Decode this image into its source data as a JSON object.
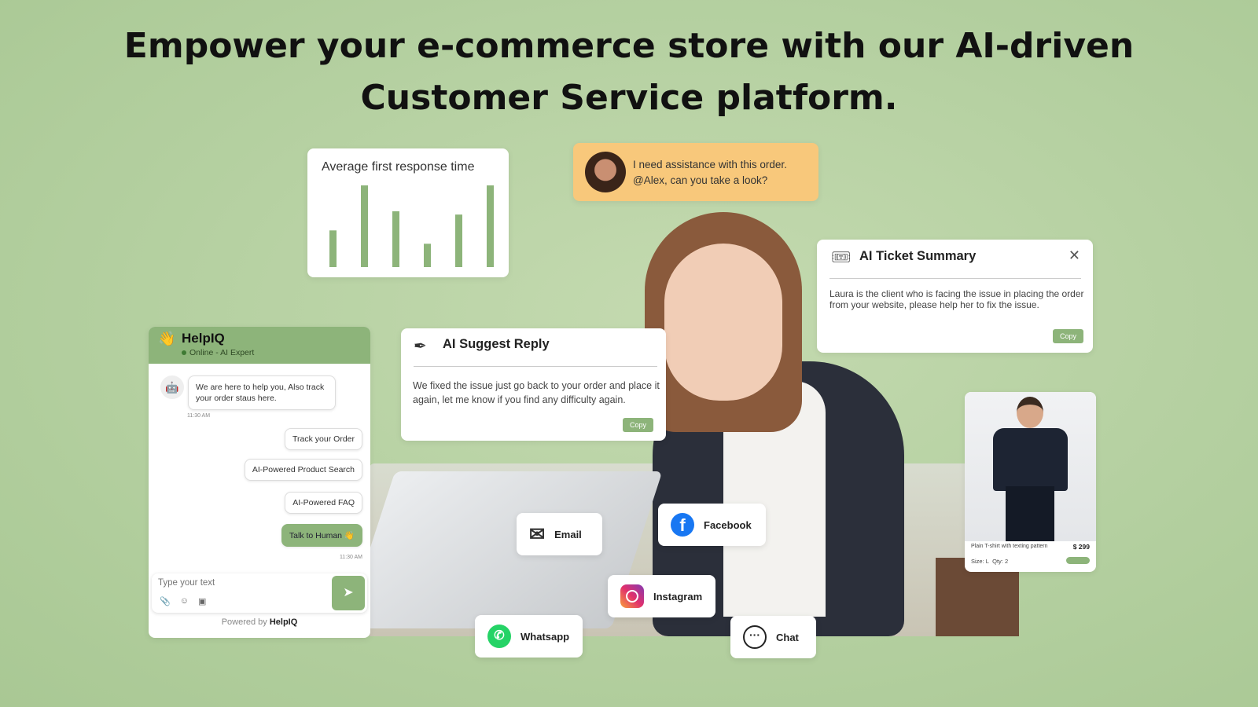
{
  "headline": {
    "line1": "Empower your e-commerce store with our AI-driven",
    "line2": "Customer Service platform."
  },
  "chart_card": {
    "title": "Average first response time"
  },
  "chart_data": {
    "type": "bar",
    "title": "Average first response time",
    "values": [
      44,
      98,
      67,
      28,
      63,
      98
    ],
    "color": "#8db47a",
    "grid": false
  },
  "quote": {
    "text1": "I need assistance with this order.",
    "text2": "@Alex, can you take a look?",
    "bg": "#f8c87b"
  },
  "ticket": {
    "title": "AI Ticket Summary",
    "body": "Laura is the client who is facing the issue in placing the order from your website, please help her to fix the issue.",
    "copy": "Copy"
  },
  "suggest": {
    "title": "AI Suggest Reply",
    "body": "We fixed the issue just go back to your order and  place it again, let me know if you find any difficulty again.",
    "copy": "Copy"
  },
  "helpiq": {
    "name": "HelpIQ",
    "status": "Online - AI Expert",
    "bot_message": "We are here to help you, Also track your order staus here.",
    "time1": "11:30 AM",
    "options": [
      "Track your Order",
      "AI-Powered Product Search",
      "AI-Powered FAQ"
    ],
    "talk": "Talk to Human 👋",
    "time2": "11:30 AM",
    "placeholder": "Type your text",
    "powered": "Powered by",
    "brand": "HelpIQ",
    "accent": "#8db47a"
  },
  "product": {
    "name": "Plain T-shirt with texting pattern",
    "price": "$ 299",
    "size": "Size: L",
    "qty": "Qty: 2"
  },
  "channels": {
    "email": "Email",
    "facebook": "Facebook",
    "instagram": "Instagram",
    "whatsapp": "Whatsapp",
    "chat": "Chat"
  }
}
